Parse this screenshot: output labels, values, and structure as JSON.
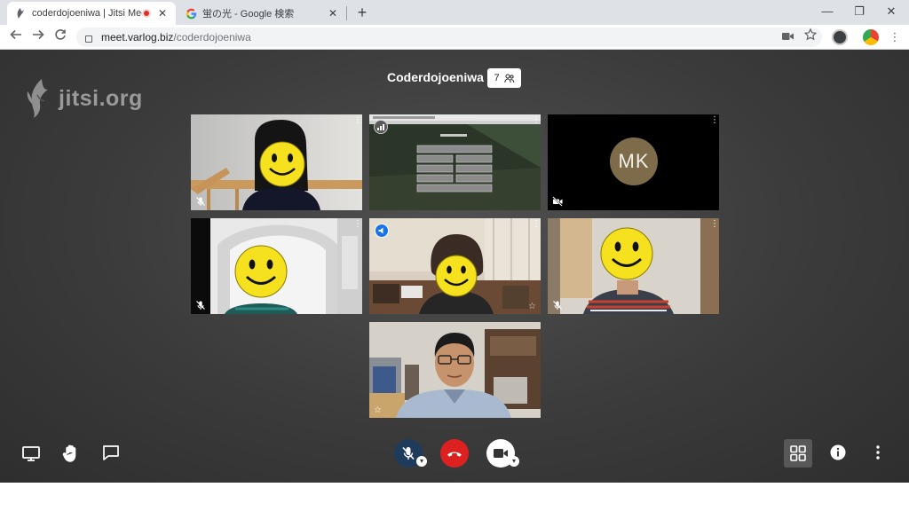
{
  "browser": {
    "tabs": [
      {
        "title": "coderdojoeniwa | Jitsi Meet",
        "active": true,
        "recording": true
      },
      {
        "title": "蛍の光 - Google 検索",
        "active": false
      }
    ],
    "new_tab_label": "+",
    "window_controls": {
      "minimize": "—",
      "restore": "❐",
      "close": "✕"
    },
    "tab_close": "✕",
    "url_host": "meet.varlog.biz",
    "url_path": "/coderdojoeniwa"
  },
  "meeting": {
    "watermark": "jitsi.org",
    "title": "Coderdojoeniwa",
    "participant_count": "7",
    "participants": [
      {
        "kind": "video",
        "scene": "girl",
        "muted": true
      },
      {
        "kind": "screen",
        "scene": "screenshare",
        "muted": false
      },
      {
        "kind": "avatar",
        "initials": "MK",
        "video_off": true
      },
      {
        "kind": "video",
        "scene": "room-left",
        "muted": true
      },
      {
        "kind": "video",
        "scene": "dominant",
        "muted": false,
        "dominant": true
      },
      {
        "kind": "video",
        "scene": "room-right",
        "muted": true
      },
      {
        "kind": "video",
        "scene": "local",
        "muted": false,
        "local": true
      }
    ]
  },
  "colors": {
    "hangup": "#dd2020",
    "dominant_border": "#2a62c6",
    "mic_muted_bg": "#1f3b5c",
    "avatar": "#7d6b4a"
  },
  "icons": {
    "toolbar_left": [
      "screen-share-icon",
      "raise-hand-icon",
      "chat-icon"
    ],
    "toolbar_center": [
      "mic-muted-icon",
      "hangup-icon",
      "camera-icon"
    ],
    "toolbar_right": [
      "tile-view-icon",
      "info-icon",
      "more-options-icon"
    ]
  }
}
